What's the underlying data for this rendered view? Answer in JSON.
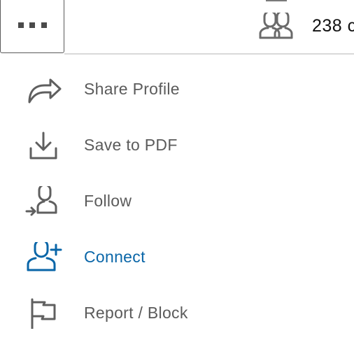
{
  "header": {
    "connections_count": "238 c"
  },
  "menu": {
    "items": [
      {
        "label": "Share Profile",
        "icon": "share-arrow-icon"
      },
      {
        "label": "Save to PDF",
        "icon": "download-icon"
      },
      {
        "label": "Follow",
        "icon": "follow-person-icon"
      },
      {
        "label": "Connect",
        "icon": "add-person-icon"
      },
      {
        "label": "Report / Block",
        "icon": "flag-icon"
      }
    ]
  },
  "colors": {
    "accent": "#0a66a8",
    "text_muted": "#5b5b5b",
    "icon_gray": "#5f5f5f",
    "divider": "#d9d9d9"
  }
}
